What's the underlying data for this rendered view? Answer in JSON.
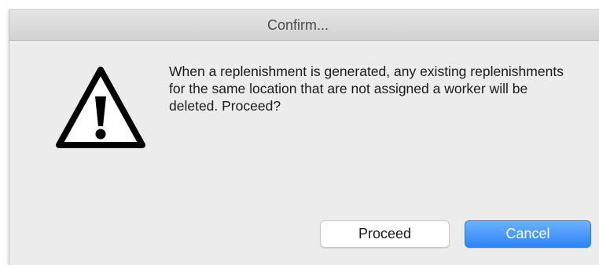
{
  "dialog": {
    "title": "Confirm...",
    "icon": "warning-triangle-icon",
    "message": "When a replenishment is generated, any existing replenishments for the same location that are not assigned a worker will be deleted. Proceed?",
    "buttons": {
      "proceed_label": "Proceed",
      "cancel_label": "Cancel"
    },
    "colors": {
      "primary_button": "#2e83f5",
      "background": "#ececec"
    }
  }
}
